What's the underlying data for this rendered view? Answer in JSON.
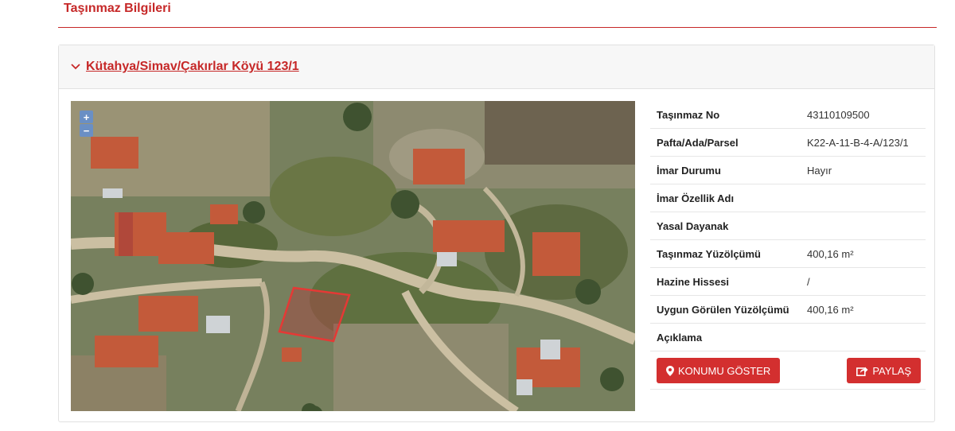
{
  "section": {
    "title": "Taşınmaz Bilgileri"
  },
  "parcel": {
    "title": "Kütahya/Simav/Çakırlar Köyü 123/1"
  },
  "map": {
    "zoom_in_label": "+",
    "zoom_out_label": "−",
    "highlight_color": "#e53935"
  },
  "details": [
    {
      "key": "Taşınmaz No",
      "value": "43110109500"
    },
    {
      "key": "Pafta/Ada/Parsel",
      "value": "K22-A-11-B-4-A/123/1"
    },
    {
      "key": "İmar Durumu",
      "value": "Hayır"
    },
    {
      "key": "İmar Özellik Adı",
      "value": ""
    },
    {
      "key": "Yasal Dayanak",
      "value": ""
    },
    {
      "key": "Taşınmaz Yüzölçümü",
      "value": "400,16 m²"
    },
    {
      "key": "Hazine Hissesi",
      "value": "/"
    },
    {
      "key": "Uygun Görülen Yüzölçümü",
      "value": "400,16 m²"
    },
    {
      "key": "Açıklama",
      "value": ""
    }
  ],
  "actions": {
    "show_location_label": "KONUMU GÖSTER",
    "show_location_icon": "map-marker-icon",
    "share_label": "PAYLAŞ",
    "share_icon": "share-icon"
  },
  "colors": {
    "accent": "#c62828",
    "button": "#d32f2f"
  }
}
